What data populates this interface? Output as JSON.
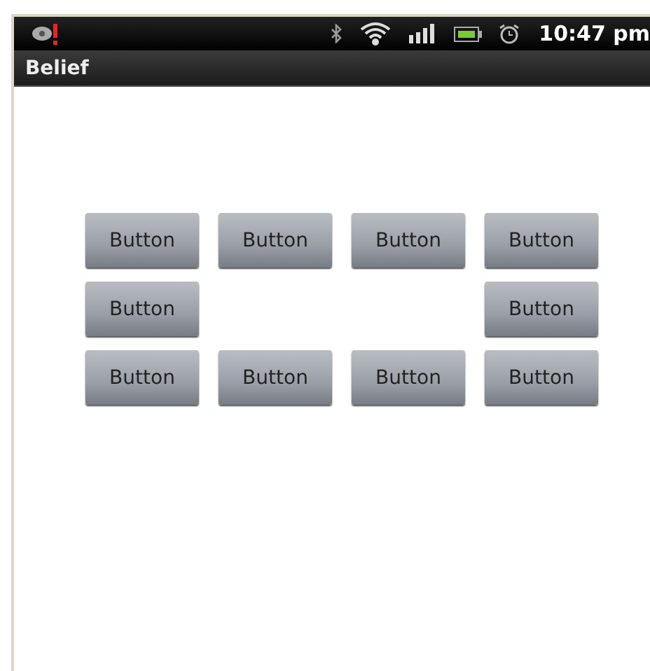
{
  "status_bar": {
    "time": "10:47 pm"
  },
  "title_bar": {
    "title": "Belief"
  },
  "grid": {
    "rows": [
      {
        "cells": [
          {
            "kind": "button",
            "label": "Button"
          },
          {
            "kind": "button",
            "label": "Button"
          },
          {
            "kind": "button",
            "label": "Button"
          },
          {
            "kind": "button",
            "label": "Button"
          }
        ]
      },
      {
        "cells": [
          {
            "kind": "button",
            "label": "Button"
          },
          {
            "kind": "empty"
          },
          {
            "kind": "empty"
          },
          {
            "kind": "button",
            "label": "Button"
          }
        ]
      },
      {
        "cells": [
          {
            "kind": "button",
            "label": "Button"
          },
          {
            "kind": "button",
            "label": "Button"
          },
          {
            "kind": "button",
            "label": "Button"
          },
          {
            "kind": "button",
            "label": "Button"
          }
        ]
      }
    ]
  }
}
